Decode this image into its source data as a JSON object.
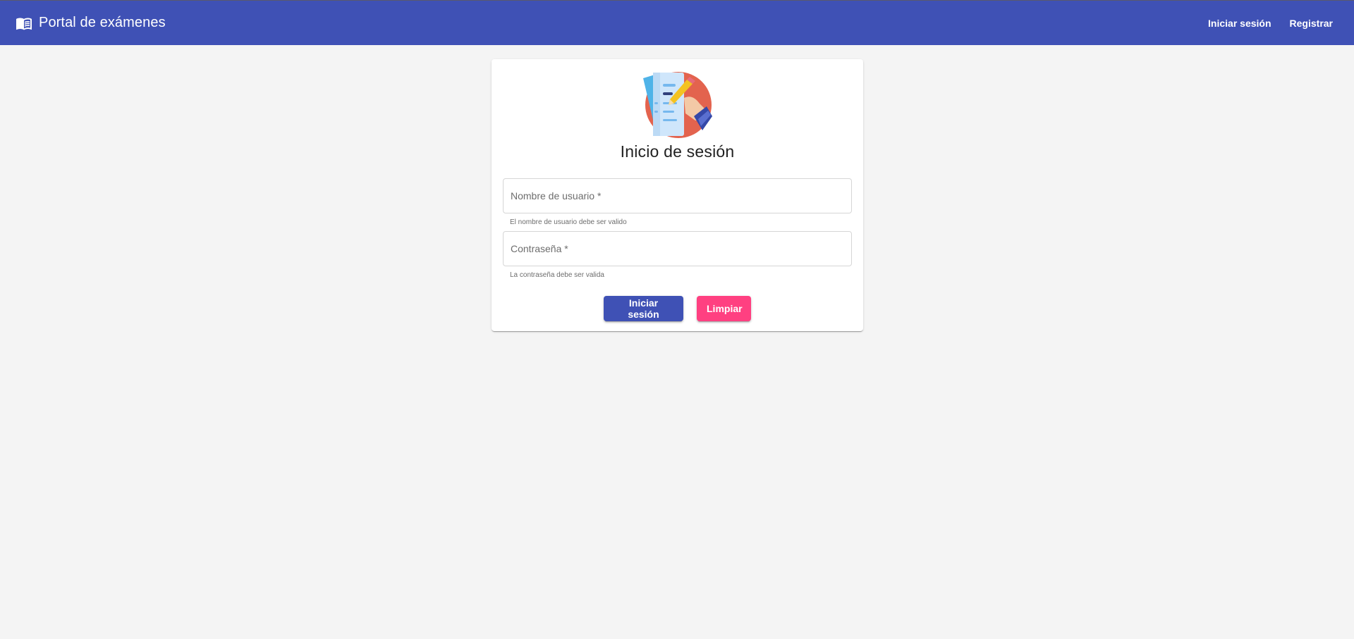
{
  "app": {
    "title": "Portal de exámenes",
    "icon": "menu-book-icon",
    "header_color": "#3f51b5"
  },
  "nav": {
    "login": "Iniciar sesión",
    "register": "Registrar"
  },
  "login_card": {
    "illustration": "exam-writing-illustration",
    "title": "Inicio de sesión",
    "username": {
      "placeholder": "Nombre de usuario *",
      "value": "",
      "hint": "El nombre de usuario debe ser valido"
    },
    "password": {
      "placeholder": "Contraseña *",
      "value": "",
      "hint": "La contraseña debe ser valida"
    },
    "buttons": {
      "login": "Iniciar sesión",
      "clear": "Limpiar"
    },
    "colors": {
      "primary": "#3f51b5",
      "accent": "#ff4081"
    }
  }
}
